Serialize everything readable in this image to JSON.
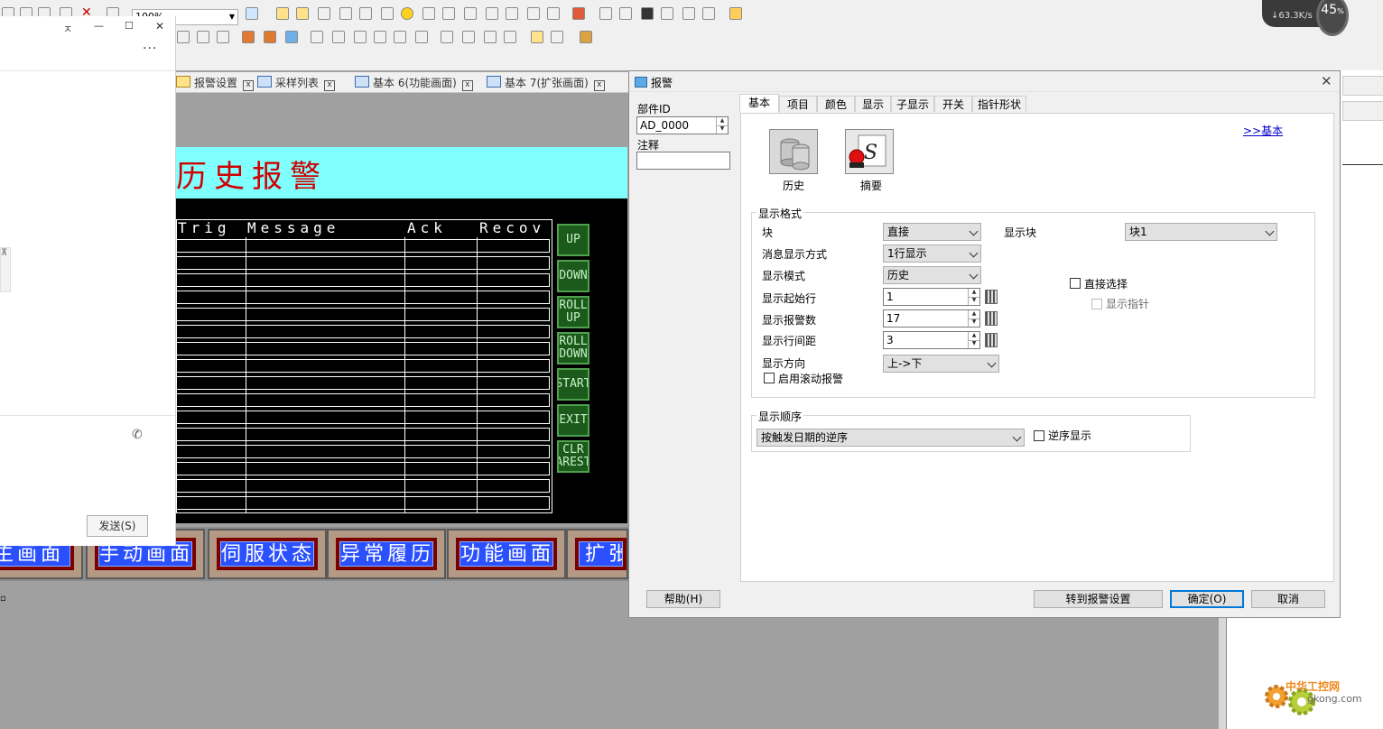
{
  "toolbar": {
    "zoom": "100%"
  },
  "doc_tabs": [
    "报警设置",
    "采样列表",
    "基本 6(功能画面)",
    "基本 7(扩张画面)"
  ],
  "canvas": {
    "title": "历史报警",
    "headers": [
      "Trig",
      "Message",
      "Ack",
      "Recov"
    ],
    "side_buttons": [
      "UP",
      "DOWN",
      "ROLL UP",
      "ROLL DOWN",
      "START",
      "EXIT",
      "CLR AREST"
    ],
    "nav_buttons": [
      "主画面",
      "手动画面",
      "伺服状态",
      "异常履历",
      "功能画面",
      "扩张画"
    ]
  },
  "chat": {
    "window_buttons": [
      "ㅈ",
      "—",
      "☐",
      "✕"
    ],
    "more": "···",
    "side_char": "⊼",
    "send_label": "发送(S)"
  },
  "net_widget": {
    "speed": "↓63.3K/s",
    "percent": "45",
    "percent_unit": "%"
  },
  "dialog": {
    "title": "报警",
    "part_id_label": "部件ID",
    "part_id_value": "AD_0000",
    "comment_label": "注释",
    "tabs": [
      "基本",
      "项目",
      "颜色",
      "显示",
      "子显示",
      "开关",
      "指针形状"
    ],
    "basic_link": ">>基本",
    "type_icons": [
      "历史",
      "摘要"
    ],
    "format_group": "显示格式",
    "block_label": "块",
    "block_value": "直接",
    "display_block_label": "显示块",
    "display_block_value": "块1",
    "msg_mode_label": "消息显示方式",
    "msg_mode_value": "1行显示",
    "display_mode_label": "显示模式",
    "display_mode_value": "历史",
    "start_row_label": "显示起始行",
    "start_row_value": "1",
    "alarm_count_label": "显示报警数",
    "alarm_count_value": "17",
    "row_spacing_label": "显示行间距",
    "row_spacing_value": "3",
    "direction_label": "显示方向",
    "direction_value": "上->下",
    "scroll_alarm_label": "启用滚动报警",
    "direct_select_label": "直接选择",
    "show_pointer_label": "显示指针",
    "order_group": "显示顺序",
    "order_value": "按触发日期的逆序",
    "reverse_label": "逆序显示",
    "help_button": "帮助(H)",
    "goto_button": "转到报警设置",
    "ok_button": "确定(O)",
    "cancel_button": "取消"
  },
  "watermark": {
    "brand": "中华工控网",
    "url": "gkong.com"
  }
}
